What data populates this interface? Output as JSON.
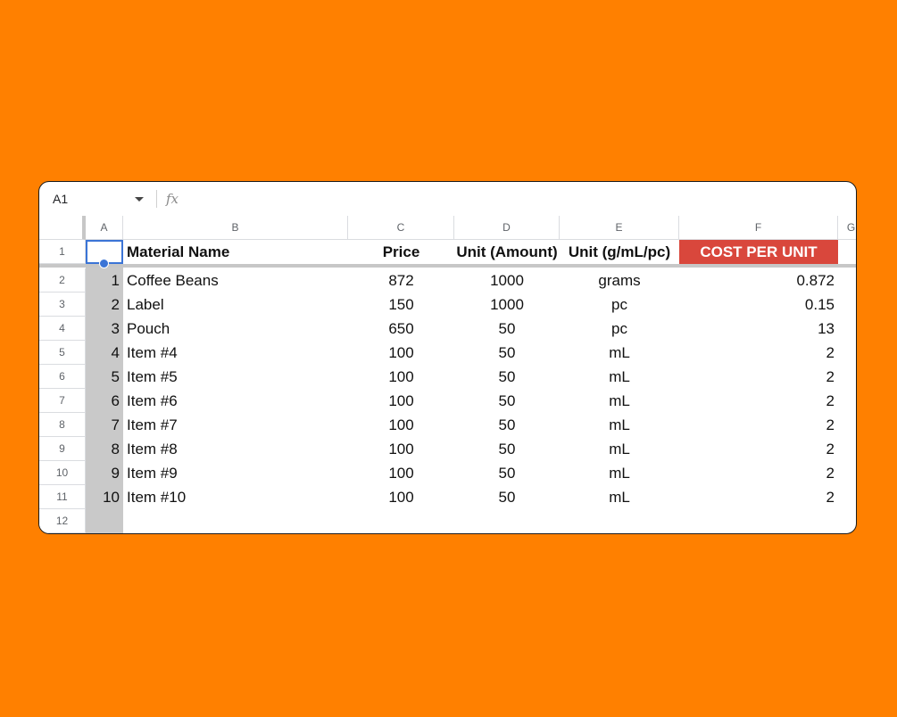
{
  "formula_bar": {
    "cell_ref": "A1",
    "fx_label": "fx",
    "formula": ""
  },
  "columns": [
    "A",
    "B",
    "C",
    "D",
    "E",
    "F",
    "G"
  ],
  "header_row": {
    "row_number": "1",
    "A": "",
    "B": "Material Name",
    "C": "Price",
    "D": "Unit (Amount)",
    "E": "Unit (g/mL/pc)",
    "F": "COST PER UNIT"
  },
  "rows": [
    {
      "row_number": "2",
      "A": "1",
      "B": "Coffee Beans",
      "C": "872",
      "D": "1000",
      "E": "grams",
      "F": "0.872"
    },
    {
      "row_number": "3",
      "A": "2",
      "B": "Label",
      "C": "150",
      "D": "1000",
      "E": "pc",
      "F": "0.15"
    },
    {
      "row_number": "4",
      "A": "3",
      "B": "Pouch",
      "C": "650",
      "D": "50",
      "E": "pc",
      "F": "13"
    },
    {
      "row_number": "5",
      "A": "4",
      "B": "Item #4",
      "C": "100",
      "D": "50",
      "E": "mL",
      "F": "2"
    },
    {
      "row_number": "6",
      "A": "5",
      "B": "Item #5",
      "C": "100",
      "D": "50",
      "E": "mL",
      "F": "2"
    },
    {
      "row_number": "7",
      "A": "6",
      "B": "Item #6",
      "C": "100",
      "D": "50",
      "E": "mL",
      "F": "2"
    },
    {
      "row_number": "8",
      "A": "7",
      "B": "Item #7",
      "C": "100",
      "D": "50",
      "E": "mL",
      "F": "2"
    },
    {
      "row_number": "9",
      "A": "8",
      "B": "Item #8",
      "C": "100",
      "D": "50",
      "E": "mL",
      "F": "2"
    },
    {
      "row_number": "10",
      "A": "9",
      "B": "Item #9",
      "C": "100",
      "D": "50",
      "E": "mL",
      "F": "2"
    },
    {
      "row_number": "11",
      "A": "10",
      "B": "Item #10",
      "C": "100",
      "D": "50",
      "E": "mL",
      "F": "2"
    },
    {
      "row_number": "12",
      "A": "",
      "B": "",
      "C": "",
      "D": "",
      "E": "",
      "F": ""
    }
  ],
  "colors": {
    "background": "#FF8000",
    "cost_header_fill": "#d9473c",
    "selection": "#3b74d6",
    "column_a_fill": "#c9c9c9"
  }
}
